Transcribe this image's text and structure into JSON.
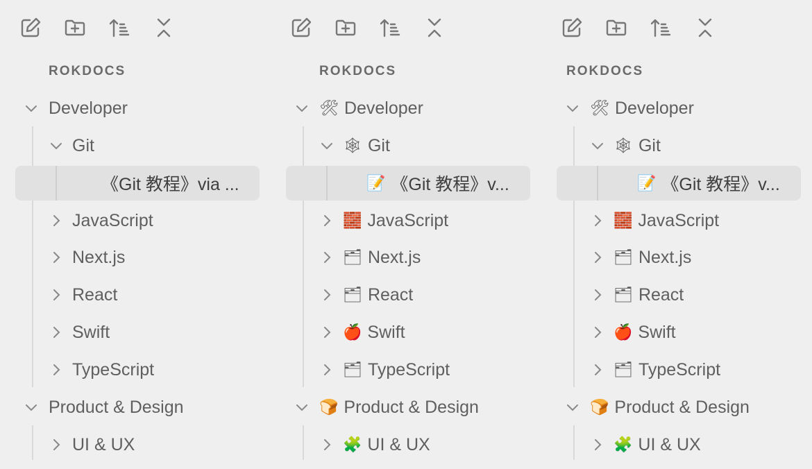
{
  "toolbar": {
    "new_note": "new-note-icon",
    "new_folder": "new-folder-icon",
    "sort": "sort-icon",
    "collapse": "collapse-all-icon"
  },
  "vault_name": "ROKDOCS",
  "panels": [
    {
      "items": {
        "developer": "Developer",
        "git": "Git",
        "git_note": "《Git 教程》via ...",
        "javascript": "JavaScript",
        "nextjs": "Next.js",
        "react": "React",
        "swift": "Swift",
        "typescript": "TypeScript",
        "product_design": "Product & Design",
        "uiux": "UI & UX"
      },
      "emojis": {}
    },
    {
      "items": {
        "developer": "Developer",
        "git": "Git",
        "git_note": "《Git 教程》v...",
        "javascript": "JavaScript",
        "nextjs": "Next.js",
        "react": "React",
        "swift": "Swift",
        "typescript": "TypeScript",
        "product_design": "Product & Design",
        "uiux": "UI & UX"
      },
      "emojis": {
        "developer": "🛠",
        "git": "🕸",
        "git_note": "📝",
        "javascript": "🧱",
        "nextjs": "🗂",
        "react": "🗂",
        "swift": "🍎",
        "typescript": "🗂",
        "product_design": "🍞",
        "uiux": "🧩"
      }
    },
    {
      "items": {
        "developer": "Developer",
        "git": "Git",
        "git_note": "《Git 教程》v...",
        "javascript": "JavaScript",
        "nextjs": "Next.js",
        "react": "React",
        "swift": "Swift",
        "typescript": "TypeScript",
        "product_design": "Product & Design",
        "uiux": "UI & UX"
      },
      "emojis": {
        "developer": "🛠",
        "git": "🕸",
        "git_note": "📝",
        "javascript": "🧱",
        "nextjs": "🗂",
        "react": "🗂",
        "swift": "🍎",
        "typescript": "🗂",
        "product_design": "🍞",
        "uiux": "🧩"
      }
    }
  ]
}
